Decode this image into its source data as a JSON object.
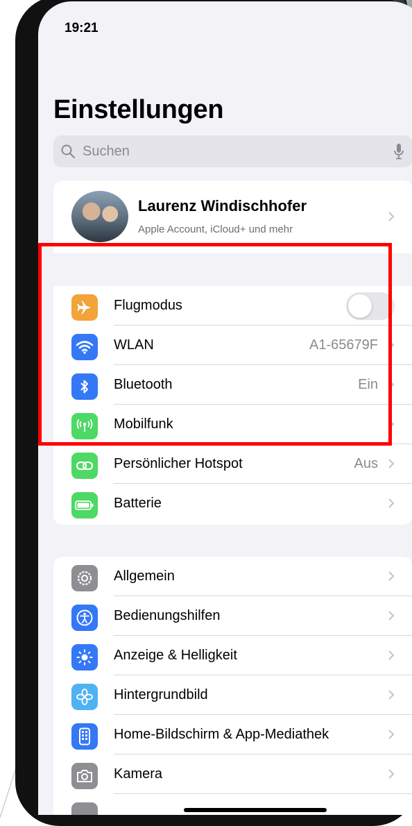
{
  "status": {
    "time": "19:21"
  },
  "title": "Einstellungen",
  "search": {
    "placeholder": "Suchen"
  },
  "profile": {
    "name": "Laurenz Windischhofer",
    "subtitle": "Apple Account, iCloud+ und mehr"
  },
  "connectivity": [
    {
      "label": "Flugmodus",
      "icon": "airplane-icon",
      "color": "#f2a33a",
      "toggle": false
    },
    {
      "label": "WLAN",
      "value": "A1-65679F",
      "icon": "wifi-icon",
      "color": "#3478f6"
    },
    {
      "label": "Bluetooth",
      "value": "Ein",
      "icon": "bluetooth-icon",
      "color": "#3478f6"
    },
    {
      "label": "Mobilfunk",
      "value": "",
      "icon": "antenna-icon",
      "color": "#4cd964"
    },
    {
      "label": "Persönlicher Hotspot",
      "value": "Aus",
      "icon": "hotspot-icon",
      "color": "#4cd964"
    },
    {
      "label": "Batterie",
      "value": "",
      "icon": "battery-icon",
      "color": "#4cd964"
    }
  ],
  "general": [
    {
      "label": "Allgemein",
      "icon": "gear-icon",
      "color": "#8e8e93"
    },
    {
      "label": "Bedienungshilfen",
      "icon": "accessibility-icon",
      "color": "#3478f6"
    },
    {
      "label": "Anzeige & Helligkeit",
      "icon": "sun-icon",
      "color": "#3478f6"
    },
    {
      "label": "Hintergrundbild",
      "icon": "flower-icon",
      "color": "#4fb3f2"
    },
    {
      "label": "Home-Bildschirm & App-Mediathek",
      "icon": "homescreen-icon",
      "color": "#3478f6"
    },
    {
      "label": "Kamera",
      "icon": "camera-icon",
      "color": "#8e8e93"
    }
  ],
  "highlight_color": "#ff0000"
}
